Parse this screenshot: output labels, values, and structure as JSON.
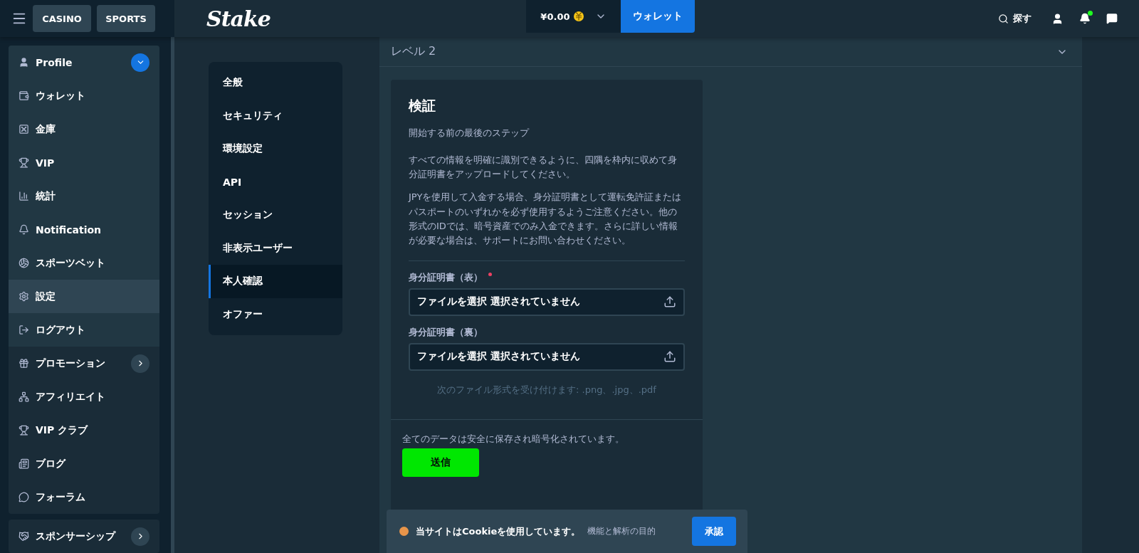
{
  "topbar": {
    "tabs": [
      {
        "label": "CASINO",
        "selected": false
      },
      {
        "label": "SPORTS",
        "selected": false
      }
    ],
    "logo": "Stake",
    "balance": "¥0.00",
    "wallet_button": "ウォレット",
    "search": "探す",
    "notification_dot": true
  },
  "sidebar": {
    "profile": {
      "label": "Profile",
      "expanded": true,
      "items": [
        {
          "label": "ウォレット",
          "selected": false
        },
        {
          "label": "金庫",
          "selected": false
        },
        {
          "label": "VIP",
          "selected": false
        },
        {
          "label": "統計",
          "selected": false
        },
        {
          "label": "Notification",
          "selected": false
        },
        {
          "label": "スポーツベット",
          "selected": false
        },
        {
          "label": "設定",
          "selected": true
        },
        {
          "label": "ログアウト",
          "selected": false
        }
      ]
    },
    "items": [
      {
        "label": "プロモーション",
        "has_submenu": true
      },
      {
        "label": "アフィリエイト",
        "has_submenu": false
      },
      {
        "label": "VIP クラブ",
        "has_submenu": false
      },
      {
        "label": "ブログ",
        "has_submenu": false
      },
      {
        "label": "フォーラム",
        "has_submenu": false
      }
    ],
    "extra": [
      {
        "label": "スポンサーシップ",
        "has_submenu": true
      }
    ]
  },
  "settings_nav": [
    {
      "label": "全般",
      "selected": false
    },
    {
      "label": "セキュリティ",
      "selected": false
    },
    {
      "label": "環境設定",
      "selected": false
    },
    {
      "label": "API",
      "selected": false
    },
    {
      "label": "セッション",
      "selected": false
    },
    {
      "label": "非表示ユーザー",
      "selected": false
    },
    {
      "label": "本人確認",
      "selected": true
    },
    {
      "label": "オファー",
      "selected": false
    }
  ],
  "level": {
    "title": "レベル 2",
    "expanded": true
  },
  "verification": {
    "title": "検証",
    "subtitle": "開始する前の最後のステップ",
    "paragraphs": [
      "すべての情報を明確に識別できるように、四隅を枠内に収めて身分証明書をアップロードしてください。",
      "JPYを使用して入金する場合、身分証明書として運転免許証またはパスポートのいずれかを必ず使用するようご注意ください。他の形式のIDでは、暗号資産でのみ入金できます。さらに詳しい情報が必要な場合は、サポートにお問い合わせください。"
    ],
    "fields": [
      {
        "label": "身分証明書（表）",
        "required": true,
        "value": "ファイルを選択 選択されていません"
      },
      {
        "label": "身分証明書（裏）",
        "required": false,
        "value": "ファイルを選択 選択されていません"
      }
    ],
    "formats": "次のファイル形式を受け付けます: .png、.jpg、.pdf",
    "footer": "全てのデータは安全に保存され暗号化されています。",
    "submit": "送信"
  },
  "cookie_banner": {
    "message": "当サイトはCookieを使用しています。",
    "detail": "機能と解析の目的",
    "accept": "承認"
  }
}
